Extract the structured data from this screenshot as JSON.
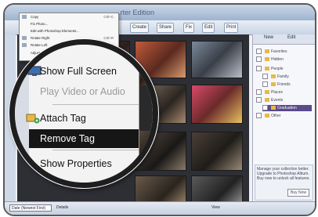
{
  "window": {
    "title": "...rter Edition"
  },
  "toolbar": {
    "buttons": [
      "Create",
      "Share",
      "Fix",
      "Edit",
      "Print"
    ]
  },
  "small_menu": {
    "items": [
      {
        "label": "Copy",
        "shortcut": "Ctrl+C"
      },
      {
        "label": "Fix Photo...",
        "shortcut": ""
      },
      {
        "label": "Edit with Photoshop Elements...",
        "shortcut": ""
      },
      {
        "label": "Rotate Right",
        "shortcut": "Ctrl+R"
      },
      {
        "label": "Rotate Left",
        "shortcut": "Ctrl+Shift+R"
      },
      {
        "label": "Adjust Date and Time...",
        "shortcut": ""
      }
    ]
  },
  "magnified_menu": {
    "items": [
      {
        "label": "Show Full Screen",
        "icon": "screen-icon",
        "state": "normal"
      },
      {
        "label": "Play Video or Audio",
        "icon": "",
        "state": "disabled"
      },
      {
        "label": "Attach Tag",
        "icon": "tag-add-icon",
        "state": "normal"
      },
      {
        "label": "Remove Tag",
        "icon": "",
        "state": "highlighted"
      },
      {
        "label": "Show Properties",
        "icon": "",
        "state": "normal"
      }
    ]
  },
  "right_panel": {
    "tabs": [
      "New",
      "Edit"
    ],
    "tags": [
      {
        "label": "Favorites",
        "selected": false
      },
      {
        "label": "Hidden",
        "selected": false
      },
      {
        "label": "People",
        "selected": false
      },
      {
        "label": "Family",
        "selected": false
      },
      {
        "label": "Friends",
        "selected": false
      },
      {
        "label": "Places",
        "selected": false
      },
      {
        "label": "Events",
        "selected": false
      },
      {
        "label": "Graduation",
        "selected": true
      },
      {
        "label": "Other",
        "selected": false
      }
    ],
    "promo_text": "Manage your collection better. Upgrade to Photoshop Album. Buy now to unlock all features.",
    "buy_label": "Buy Now"
  },
  "statusbar": {
    "sort": "Date (Newest First)",
    "details": "Details",
    "view": "View"
  },
  "colors": {
    "highlight": "#161616",
    "selected_tag": "#5a4a8a"
  }
}
